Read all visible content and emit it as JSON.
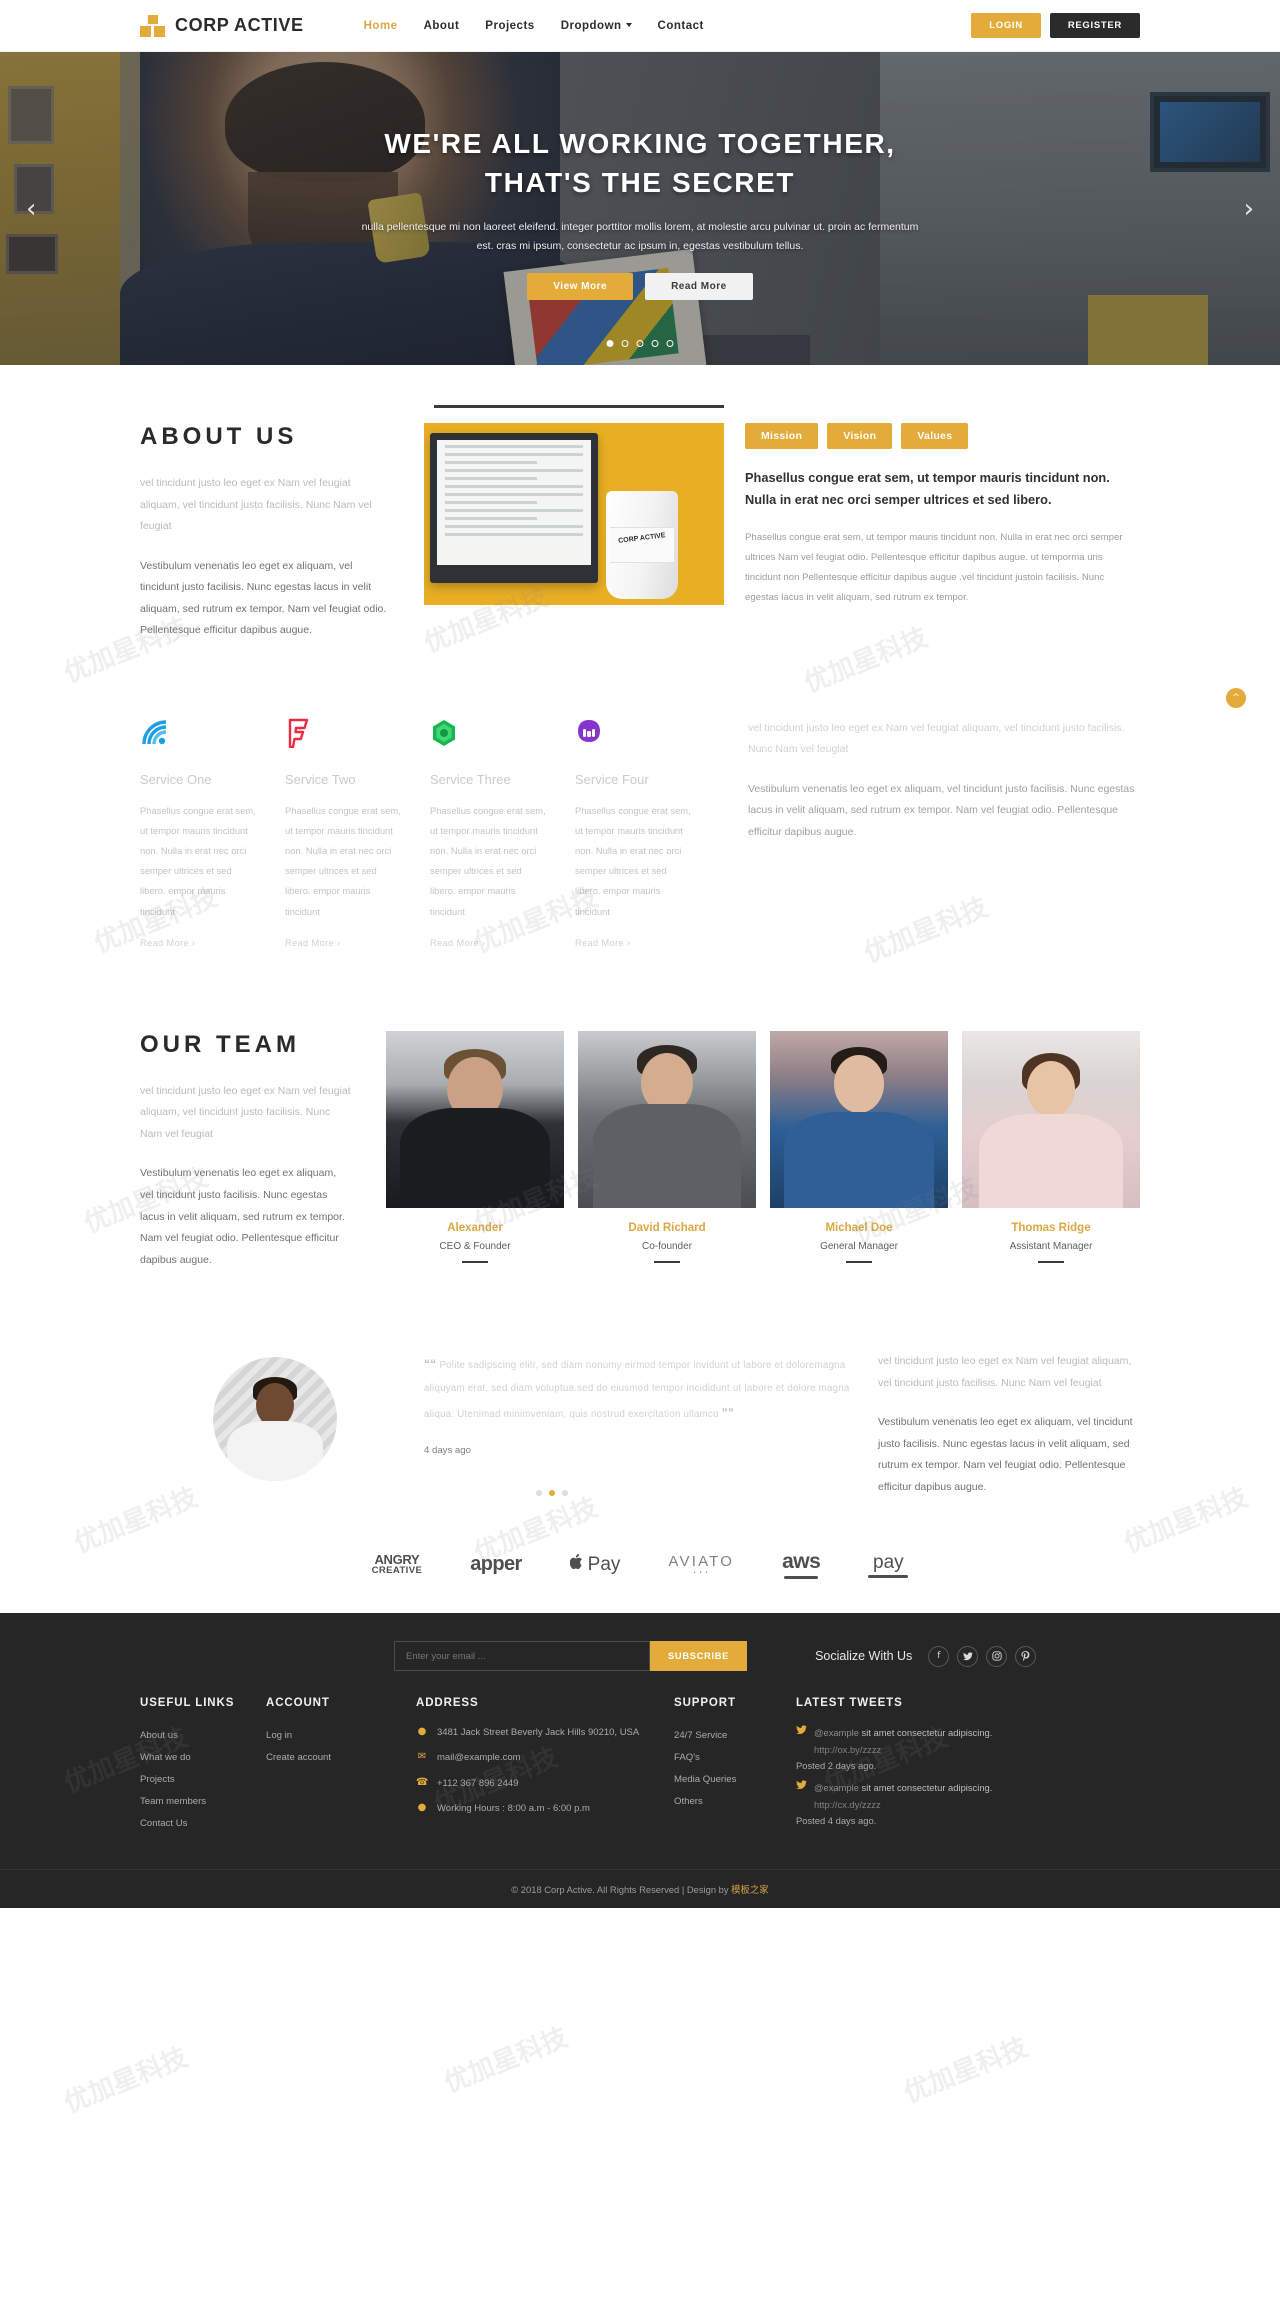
{
  "header": {
    "brand": "CORP ACTIVE",
    "nav": [
      {
        "label": "Home",
        "active": true
      },
      {
        "label": "About",
        "active": false
      },
      {
        "label": "Projects",
        "active": false
      },
      {
        "label": "Dropdown",
        "active": false,
        "caret": true
      },
      {
        "label": "Contact",
        "active": false
      }
    ],
    "login_label": "LOGIN",
    "register_label": "REGISTER"
  },
  "hero": {
    "title_line1": "WE'RE ALL WORKING TOGETHER,",
    "title_line2": "THAT'S THE SECRET",
    "subtitle": "nulla pellentesque mi non laoreet eleifend. integer porttitor mollis lorem, at molestie arcu pulvinar ut. proin ac fermentum est. cras mi ipsum, consectetur ac ipsum in, egestas vestibulum tellus.",
    "btn_primary": "View More",
    "btn_secondary": "Read More",
    "prev_icon": "chevron-left-icon",
    "next_icon": "chevron-right-icon",
    "dots": 5,
    "active_dot": 0
  },
  "about": {
    "title": "ABOUT US",
    "muted": "vel tincidunt justo leo eget ex Nam vel feugiat aliquam, vel tincidunt justo facilisis. Nunc Nam vel feugiat",
    "body": "Vestibulum venenatis leo eget ex aliquam, vel tincidunt justo facilisis. Nunc egestas lacus in velit aliquam, sed rutrum ex tempor. Nam vel feugiat odio. Pellentesque efficitur dapibus augue.",
    "cup_text": "CORP ACTIVE",
    "tabs": [
      "Mission",
      "Vision",
      "Values"
    ],
    "lead": "Phasellus congue erat sem, ut tempor mauris tincidunt non. Nulla in erat nec orci semper ultrices et sed libero.",
    "paragraph": "Phasellus congue erat sem, ut tempor mauris tincidunt non. Nulla in erat nec orci semper ultrices Nam vel feugiat odio. Pellentesque efficitur dapibus augue. ut temporma uris tincidunt non Pellentesque efficitur dapibus augue .vel tincidunt justoin facilisis. Nunc egestas lacus in velit aliquam, sed rutrum ex tempor."
  },
  "services": {
    "items": [
      {
        "title": "Service One",
        "icon": "wifi-waves-icon",
        "color": "#1e9fe3",
        "text": "Phasellus congue erat sem, ut tempor mauris tincidunt non. Nulla in erat nec orci semper ultrices et sed libero. empor mauris tincidunt",
        "more": "Read More"
      },
      {
        "title": "Service Two",
        "icon": "foursquare-flag-icon",
        "color": "#ec2b40",
        "text": "Phasellus congue erat sem, ut tempor mauris tincidunt non. Nulla in erat nec orci semper ultrices et sed libero. empor mauris tincidunt",
        "more": "Read More"
      },
      {
        "title": "Service Three",
        "icon": "hexagon-burst-icon",
        "color": "#14b84b",
        "text": "Phasellus congue erat sem, ut tempor mauris tincidunt non. Nulla in erat nec orci semper ultrices et sed libero. empor mauris tincidunt",
        "more": "Read More"
      },
      {
        "title": "Service Four",
        "icon": "mastodon-icon",
        "color": "#8833cc",
        "text": "Phasellus congue erat sem, ut tempor mauris tincidunt non. Nulla in erat nec orci semper ultrices et sed libero. empor mauris tincidunt",
        "more": "Read More"
      }
    ],
    "side_muted": "vel tincidunt justo leo eget ex Nam vel feugiat aliquam, vel tincidunt justo facilisis. Nunc Nam vel feugiat",
    "side_body": "Vestibulum venenatis leo eget ex aliquam, vel tincidunt justo facilisis. Nunc egestas lacus in velit aliquam, sed rutrum ex tempor. Nam vel feugiat odio. Pellentesque efficitur dapibus augue."
  },
  "team": {
    "title": "OUR TEAM",
    "muted": "vel tincidunt justo leo eget ex Nam vel feugiat aliquam, vel tincidunt justo facilisis. Nunc Nam vel feugiat",
    "body": "Vestibulum venenatis leo eget ex aliquam, vel tincidunt justo facilisis. Nunc egestas lacus in velit aliquam, sed rutrum ex tempor. Nam vel feugiat odio. Pellentesque efficitur dapibus augue.",
    "members": [
      {
        "name": "Alexander",
        "role": "CEO & Founder"
      },
      {
        "name": "David Richard",
        "role": "Co-founder"
      },
      {
        "name": "Michael Doe",
        "role": "General Manager"
      },
      {
        "name": "Thomas Ridge",
        "role": "Assistant Manager"
      }
    ]
  },
  "testimonial": {
    "quote": "Polite sadipscing elitr, sed diam nonumy eirmod tempor invidunt ut labore et doloremagna aliquyam erat, sed diam voluptua.sed do eiusmod tempor incididunt ut labore et dolore magna aliqua. Utenimad minimveniam, quis nostrud exercitation ullamco",
    "ago": "4 days ago",
    "side_muted": "vel tincidunt justo leo eget ex Nam vel feugiat aliquam, vel tincidunt justo facilisis. Nunc Nam vel feugiat",
    "side_body": "Vestibulum venenatis leo eget ex aliquam, vel tincidunt justo facilisis. Nunc egestas lacus in velit aliquam, sed rutrum ex tempor. Nam vel feugiat odio. Pellentesque efficitur dapibus augue.",
    "dots": 3,
    "active_dot": 1
  },
  "brands": [
    {
      "name": "ANGRY CREATIVE",
      "top": "ANGRY",
      "bottom": "CREATIVE"
    },
    {
      "name": "apper",
      "label": "apper"
    },
    {
      "name": "Apple Pay",
      "label": "Pay",
      "glyph": ""
    },
    {
      "name": "AVIATO",
      "label": "AVIATO",
      "sub": "• • •"
    },
    {
      "name": "aws",
      "label": "aws"
    },
    {
      "name": "amazon pay",
      "label": "pay"
    }
  ],
  "footer": {
    "email_placeholder": "Enter your email ...",
    "subscribe_label": "SUBSCRIBE",
    "socialize_label": "Socialize With Us",
    "socials": [
      "facebook-icon",
      "twitter-icon",
      "instagram-icon",
      "pinterest-icon"
    ],
    "social_glyphs": [
      "f",
      "ᵗ",
      "◎",
      "ᵖ"
    ],
    "columns": {
      "useful_links": {
        "heading": "USEFUL LINKS",
        "items": [
          "About us",
          "What we do",
          "Projects",
          "Team members",
          "Contact Us"
        ]
      },
      "account": {
        "heading": "ACCOUNT",
        "items": [
          "Log in",
          "Create account"
        ]
      },
      "address": {
        "heading": "ADDRESS",
        "rows": [
          {
            "icon": "location-pin-icon",
            "text": "3481 Jack Street Beverly Jack Hills 90210, USA"
          },
          {
            "icon": "envelope-icon",
            "text": "mail@example.com"
          },
          {
            "icon": "phone-icon",
            "text": "+112 367 896 2449"
          },
          {
            "icon": "clock-icon",
            "text": "Working Hours : 8:00 a.m - 6:00 p.m"
          }
        ]
      },
      "support": {
        "heading": "SUPPORT",
        "items": [
          "24/7 Service",
          "FAQ's",
          "Media Queries",
          "Others"
        ]
      },
      "tweets": {
        "heading": "LATEST TWEETS",
        "items": [
          {
            "handle": "@example",
            "text": " sit amet consectetur adipiscing. ",
            "url": "http://ox.by/zzzz",
            "posted": "Posted 2 days ago."
          },
          {
            "handle": "@example",
            "text": " sit amet consectetur adipiscing. ",
            "url": "http://cx.dy/zzzz",
            "posted": "Posted 4 days ago."
          }
        ]
      }
    },
    "copyright_pre": "© 2018 Corp Active. All Rights Reserved | Design by ",
    "copyright_brand": "模板之家"
  },
  "scroll_top_icon": "chevron-up-icon",
  "watermark": "优加星科技",
  "colors": {
    "accent": "#e3ab3a",
    "dark": "#262626",
    "text": "#4a4a4a"
  }
}
